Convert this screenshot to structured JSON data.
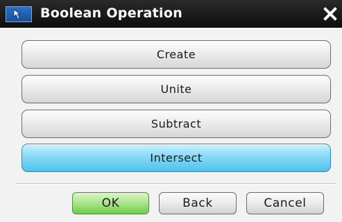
{
  "window": {
    "title": "Boolean Operation",
    "icon": "select-arrow-icon",
    "close_icon": "close-icon"
  },
  "operations": {
    "items": [
      {
        "label": "Create",
        "selected": false
      },
      {
        "label": "Unite",
        "selected": false
      },
      {
        "label": "Subtract",
        "selected": false
      },
      {
        "label": "Intersect",
        "selected": true
      }
    ]
  },
  "footer": {
    "ok_label": "OK",
    "back_label": "Back",
    "cancel_label": "Cancel"
  },
  "colors": {
    "titlebar": "#0e0e0e",
    "selected_button": "#4fc2ea",
    "ok_button": "#6fcb4c",
    "background": "#f2f2f2"
  }
}
